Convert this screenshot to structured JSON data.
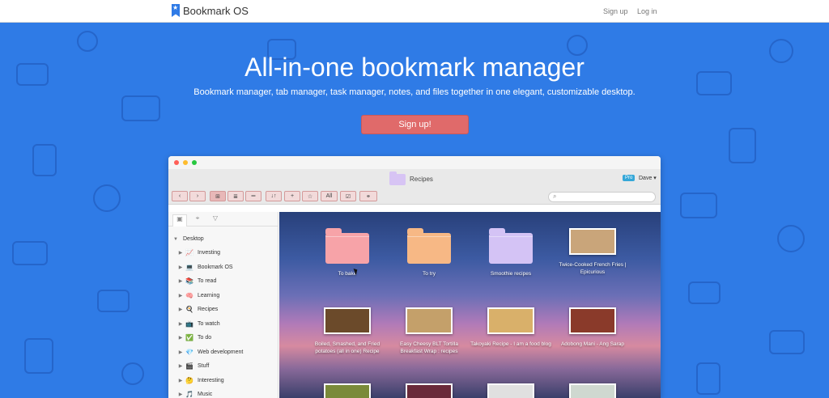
{
  "brand": {
    "name": "Bookmark OS",
    "logo_icon": "star"
  },
  "nav": {
    "signup": "Sign up",
    "login": "Log in"
  },
  "hero": {
    "title": "All-in-one bookmark manager",
    "subtitle": "Bookmark manager, tab manager, task manager, notes, and files together in one elegant, customizable desktop.",
    "cta": "Sign up!"
  },
  "colors": {
    "hero_bg": "#2f7be6",
    "cta": "#e06a6a",
    "pro_badge": "#35a7d8"
  },
  "app": {
    "current_folder": "Recipes",
    "pro_badge": "Pro",
    "user": "Dave ▾",
    "search_icon": "⌕",
    "toolbar": {
      "back": "‹",
      "forward": "›",
      "view_grid": "⊞",
      "view_list": "≣",
      "view_compact": "═",
      "sort": "↓↑",
      "add": "+",
      "star": "☆",
      "all": "All",
      "tasks": "☑",
      "link": "⚭"
    },
    "sidebar_tabs": {
      "folders_icon": "▣",
      "tags_icon": "⌖",
      "filter_icon": "▽"
    },
    "tree_root": "Desktop",
    "tree": [
      {
        "emoji": "📈",
        "label": "Investing"
      },
      {
        "emoji": "💻",
        "label": "Bookmark OS"
      },
      {
        "emoji": "📚",
        "label": "To read"
      },
      {
        "emoji": "🧠",
        "label": "Learning"
      },
      {
        "emoji": "🍳",
        "label": "Recipes"
      },
      {
        "emoji": "📺",
        "label": "To watch"
      },
      {
        "emoji": "✅",
        "label": "To do"
      },
      {
        "emoji": "💎",
        "label": "Web development"
      },
      {
        "emoji": "🎬",
        "label": "Stuff"
      },
      {
        "emoji": "🤔",
        "label": "Interesting"
      },
      {
        "emoji": "🎵",
        "label": "Music"
      }
    ],
    "tiles": [
      {
        "type": "folder",
        "label": "To bake",
        "color": "#f7a3a8"
      },
      {
        "type": "folder",
        "label": "To try",
        "color": "#f7b885"
      },
      {
        "type": "folder",
        "label": "Smoothie recipes",
        "color": "#d4c3f5"
      },
      {
        "type": "thumb",
        "label": "Twice-Cooked French Fries | Epicurious",
        "color": "#c9a57a"
      },
      {
        "type": "thumb",
        "label": "Boiled, Smashed, and Fried potatoes (all in one) Recipe",
        "color": "#6b4a2a"
      },
      {
        "type": "thumb",
        "label": "Easy Cheesy BLT Tortilla Breakfast Wrap : recipes",
        "color": "#c4a06a"
      },
      {
        "type": "thumb",
        "label": "Takoyaki Recipe - I am a food blog",
        "color": "#d9b06a"
      },
      {
        "type": "thumb",
        "label": "Adobong Mani - Ang Sarap",
        "color": "#8a3a2a"
      }
    ],
    "bottom_row_thumbs": [
      {
        "color": "#7a8a3a"
      },
      {
        "color": "#6a2a3a"
      },
      {
        "color": "#e0e0e0"
      },
      {
        "color": "#cfd8d0"
      }
    ]
  }
}
